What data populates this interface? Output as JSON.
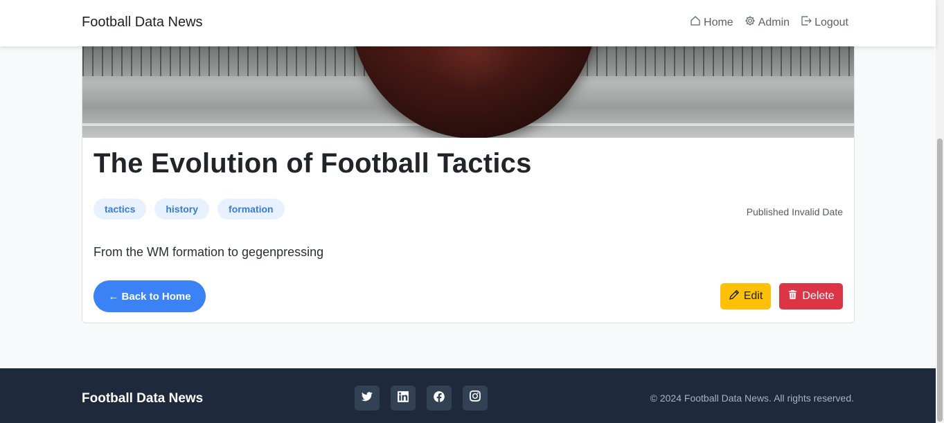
{
  "navbar": {
    "brand": "Football Data News",
    "links": [
      {
        "label": "Home",
        "icon": "house-icon"
      },
      {
        "label": "Admin",
        "icon": "gear-icon"
      },
      {
        "label": "Logout",
        "icon": "logout-icon"
      }
    ]
  },
  "article": {
    "title": "The Evolution of Football Tactics",
    "tags": [
      "tactics",
      "history",
      "formation"
    ],
    "published": "Published Invalid Date",
    "summary": "From the WM formation to gegenpressing",
    "back_label": "← Back to Home",
    "edit_label": "Edit",
    "delete_label": "Delete"
  },
  "footer": {
    "brand": "Football Data News",
    "socials": [
      "twitter-icon",
      "linkedin-icon",
      "facebook-icon",
      "instagram-icon"
    ],
    "copyright": "© 2024 Football Data News. All rights reserved."
  },
  "colors": {
    "primary": "#3b82f6",
    "warning": "#ffc107",
    "danger": "#dc3545",
    "tag_bg": "#e7f1ff",
    "tag_text": "#3b7bd4",
    "footer_bg": "#1e293b"
  }
}
